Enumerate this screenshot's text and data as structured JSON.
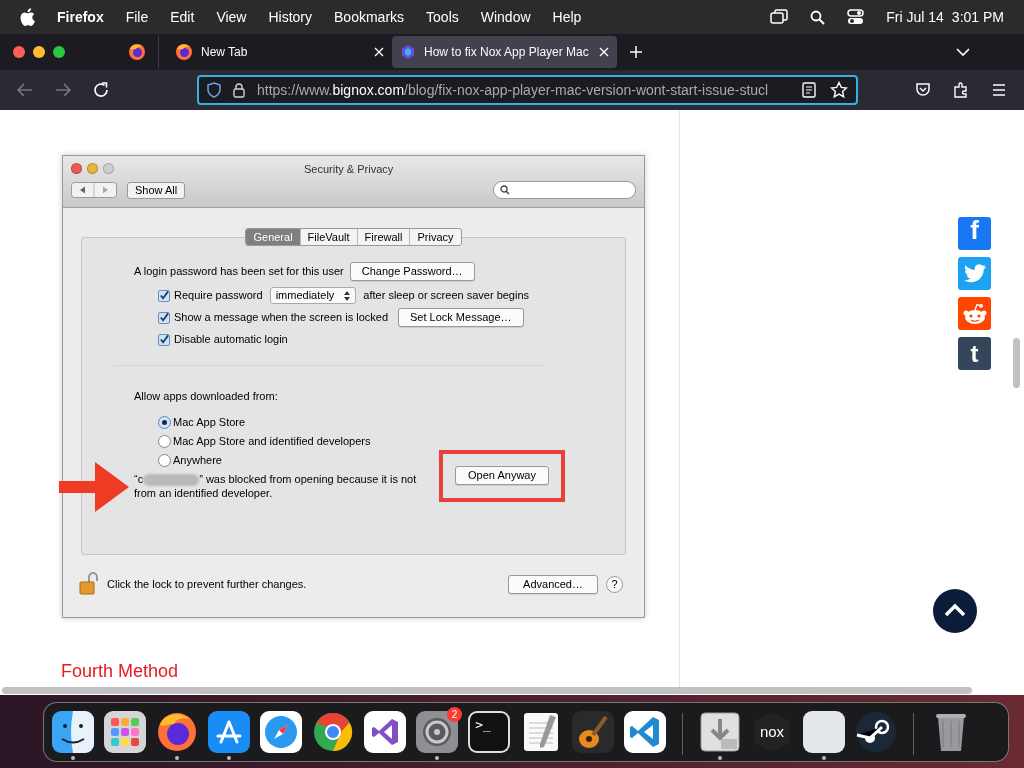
{
  "menu_bar": {
    "app": "Firefox",
    "menus": [
      "File",
      "Edit",
      "View",
      "History",
      "Bookmarks",
      "Tools",
      "Window",
      "Help"
    ],
    "date": "Fri Jul 14",
    "time": "3:01 PM"
  },
  "tabs": [
    {
      "kind": "pinned",
      "selected": false
    },
    {
      "kind": "page",
      "label": "New Tab",
      "selected": false
    },
    {
      "kind": "page",
      "label": "How to fix Nox App Player Mac",
      "selected": true
    }
  ],
  "address_bar": {
    "url": "https://www.**bignox.com**/blog/fix-nox-app-player-mac-version-wont-start-issue-stucl"
  },
  "dialog": {
    "title": "Security & Privacy",
    "show_all": "Show All",
    "tabs": [
      {
        "label": "General",
        "selected": true
      },
      {
        "label": "FileVault",
        "selected": false
      },
      {
        "label": "Firewall",
        "selected": false
      },
      {
        "label": "Privacy",
        "selected": false
      }
    ],
    "password_text": "A login password has been set for this user",
    "change_password": "Change Password…",
    "options": [
      {
        "kind": "select",
        "label": "Require password",
        "checked": true,
        "value": "immediately",
        "suffix": "after sleep or screen saver begins"
      },
      {
        "kind": "button",
        "label": "Show a message when the screen is locked",
        "checked": true,
        "button": "Set Lock Message…"
      },
      {
        "kind": "plain",
        "label": "Disable automatic login",
        "checked": true
      }
    ],
    "allow_label": "Allow apps downloaded from:",
    "sources": [
      {
        "label": "Mac App Store",
        "selected": true
      },
      {
        "label": "Mac App Store and identified developers",
        "selected": false
      },
      {
        "label": "Anywhere",
        "selected": false
      }
    ],
    "blocked_start": "“c",
    "blocked_rest": "” was blocked from opening because it is not from an identified developer.",
    "open_anyway": "Open Anyway",
    "lock_text": "Click the lock to prevent further changes.",
    "advanced": "Advanced…",
    "help": "?"
  },
  "heading": "Fourth Method",
  "share": [
    {
      "kind": "facebook",
      "glyph": "f"
    },
    {
      "kind": "twitter"
    },
    {
      "kind": "reddit"
    },
    {
      "kind": "tumblr",
      "glyph": "t"
    }
  ],
  "dock": [
    {
      "kind": "finder",
      "running": true
    },
    {
      "kind": "launchpad",
      "running": false
    },
    {
      "kind": "firefox",
      "running": true
    },
    {
      "kind": "appstore",
      "running": true
    },
    {
      "kind": "safari",
      "running": false
    },
    {
      "kind": "chrome",
      "running": false
    },
    {
      "kind": "vs",
      "running": false
    },
    {
      "kind": "settings",
      "running": true,
      "badge": "2"
    },
    {
      "kind": "terminal",
      "running": false,
      "glyph": ">_"
    },
    {
      "kind": "textedit",
      "running": false
    },
    {
      "kind": "guitar",
      "running": false
    },
    {
      "kind": "vscode",
      "running": false
    },
    {
      "kind": "sep"
    },
    {
      "kind": "installer",
      "running": true
    },
    {
      "kind": "nox",
      "running": false,
      "glyph": "nox"
    },
    {
      "kind": "blank",
      "running": true
    },
    {
      "kind": "steam",
      "running": false
    },
    {
      "kind": "sep"
    },
    {
      "kind": "trash",
      "running": false
    }
  ]
}
